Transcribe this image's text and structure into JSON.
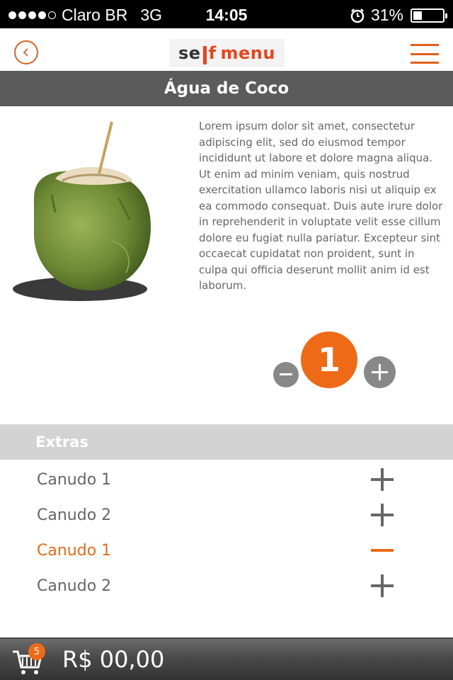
{
  "status_bar": {
    "carrier": "Claro BR",
    "network": "3G",
    "time": "14:05",
    "battery": "31%",
    "battery_level": 0.31
  },
  "header": {
    "logo_text_1": "se",
    "logo_text_2": "f",
    "logo_text_3": "menu",
    "accent_color": "#ef6a17"
  },
  "product": {
    "title": "Água de Coco",
    "description": "Lorem ipsum dolor sit amet, consectetur adipiscing elit, sed do eiusmod tempor incididunt ut labore et dolore magna aliqua. Ut enim ad minim veniam, quis nostrud exercitation ullamco laboris nisi ut aliquip ex ea commodo consequat. Duis aute irure dolor in reprehenderit in voluptate velit esse cillum dolore eu fugiat nulla pariatur. Excepteur sint occaecat cupidatat non proident, sunt in culpa qui officia deserunt mollit anim id est laborum."
  },
  "quantity": {
    "value": "1"
  },
  "extras": {
    "header": "Extras",
    "items": [
      {
        "label": "Canudo 1",
        "selected": false
      },
      {
        "label": "Canudo 2",
        "selected": false
      },
      {
        "label": "Canudo 1",
        "selected": true
      },
      {
        "label": "Canudo 2",
        "selected": false
      }
    ]
  },
  "cart": {
    "count": "5",
    "total": "R$ 00,00"
  }
}
